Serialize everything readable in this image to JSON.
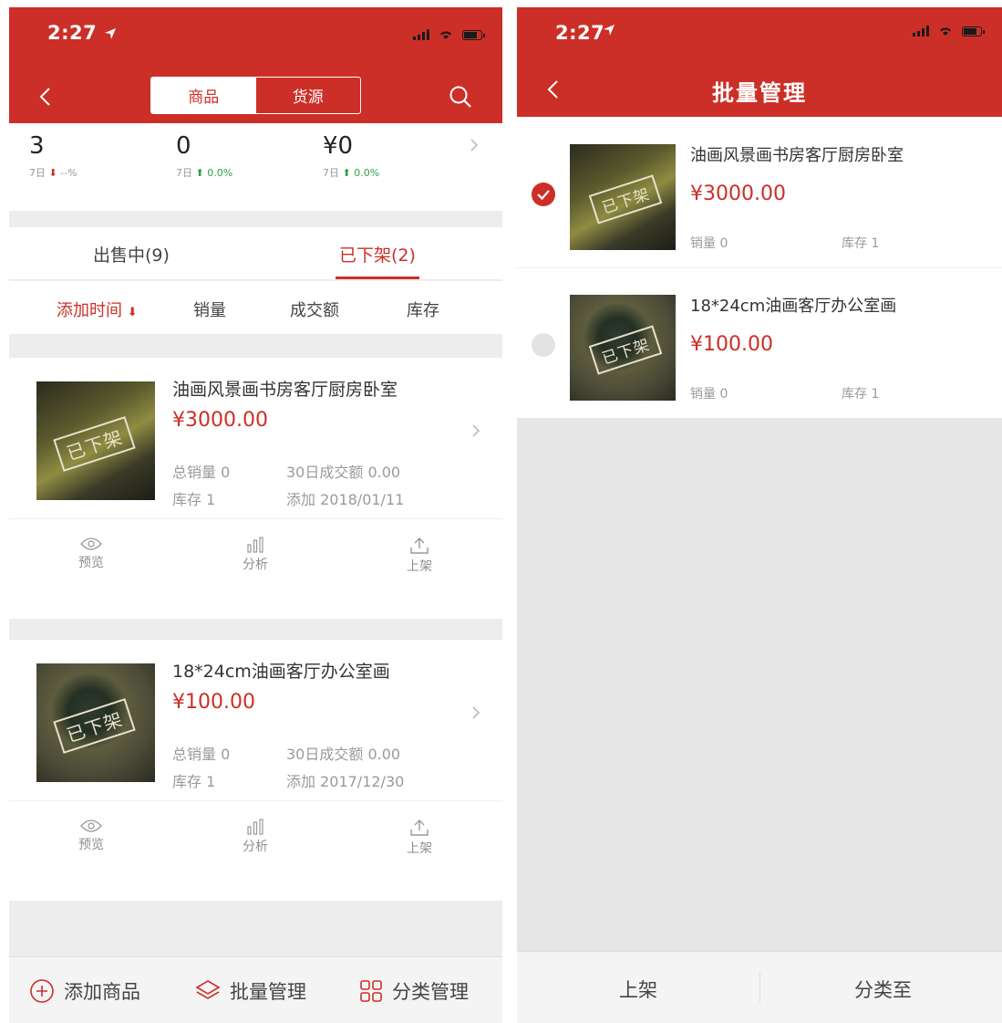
{
  "left": {
    "status": {
      "time": "2:27"
    },
    "segment": {
      "goods": "商品",
      "supply": "货源"
    },
    "stats": [
      {
        "value": "3",
        "sub_prefix": "7日",
        "arrow": "⬇",
        "change": "--%"
      },
      {
        "value": "0",
        "sub_prefix": "7日",
        "arrow": "⬆",
        "change": "0.0%"
      },
      {
        "value": "¥0",
        "sub_prefix": "7日",
        "arrow": "⬆",
        "change": "0.0%"
      }
    ],
    "tabs": {
      "on_sale": "出售中(9)",
      "off_shelf": "已下架(2)"
    },
    "sort": {
      "add_time": "添加时间",
      "sales": "销量",
      "turnover": "成交额",
      "stock": "库存"
    },
    "products": [
      {
        "name": "油画风景画书房客厅厨房卧室",
        "price": "¥3000.00",
        "stamp": "已下架",
        "total_sales": "总销量 0",
        "stock": "库存 1",
        "turnover_30d": "30日成交额 0.00",
        "added": "添加 2018/01/11"
      },
      {
        "name": "18*24cm油画客厅办公室画",
        "price": "¥100.00",
        "stamp": "已下架",
        "total_sales": "总销量 0",
        "stock": "库存 1",
        "turnover_30d": "30日成交额 0.00",
        "added": "添加 2017/12/30"
      }
    ],
    "actions": {
      "preview": "预览",
      "analysis": "分析",
      "list": "上架"
    },
    "bottom": {
      "add": "添加商品",
      "batch": "批量管理",
      "category": "分类管理"
    }
  },
  "right": {
    "status": {
      "time": "2:27"
    },
    "title": "批量管理",
    "items": [
      {
        "name": "油画风景画书房客厅厨房卧室",
        "price": "¥3000.00",
        "stamp": "已下架",
        "sales": "销量 0",
        "stock": "库存 1",
        "selected": true
      },
      {
        "name": "18*24cm油画客厅办公室画",
        "price": "¥100.00",
        "stamp": "已下架",
        "sales": "销量 0",
        "stock": "库存 1",
        "selected": false
      }
    ],
    "bottom": {
      "list": "上架",
      "categorize": "分类至"
    }
  },
  "colors": {
    "brand": "#cc2f27",
    "up": "#2f9e44",
    "muted": "#9a9a9a"
  }
}
